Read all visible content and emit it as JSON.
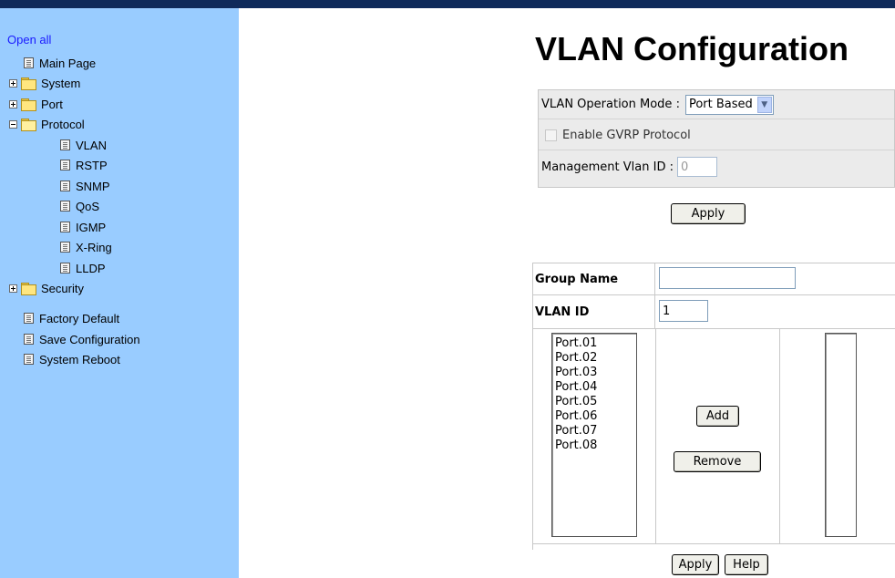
{
  "sidebar": {
    "open_all": "Open all",
    "items": [
      {
        "label": "Main Page",
        "icon": "page-icon"
      },
      {
        "label": "System",
        "icon": "folder-icon"
      },
      {
        "label": "Port",
        "icon": "folder-icon"
      },
      {
        "label": "Protocol",
        "icon": "folder-open-icon"
      },
      {
        "label": "VLAN",
        "icon": "page-icon"
      },
      {
        "label": "RSTP",
        "icon": "page-icon"
      },
      {
        "label": "SNMP",
        "icon": "page-icon"
      },
      {
        "label": "QoS",
        "icon": "page-icon"
      },
      {
        "label": "IGMP",
        "icon": "page-icon"
      },
      {
        "label": "X-Ring",
        "icon": "page-icon"
      },
      {
        "label": "LLDP",
        "icon": "page-icon"
      },
      {
        "label": "Security",
        "icon": "folder-icon"
      },
      {
        "label": "Factory Default",
        "icon": "page-icon"
      },
      {
        "label": "Save Configuration",
        "icon": "page-icon"
      },
      {
        "label": "System Reboot",
        "icon": "page-icon"
      }
    ]
  },
  "main": {
    "title": "VLAN Configuration",
    "mode_label": "VLAN Operation Mode :",
    "mode_value": "Port Based",
    "gvrp_label": "Enable GVRP Protocol",
    "mgmt_label": "Management Vlan ID :",
    "mgmt_value": "0",
    "apply_label": "Apply"
  },
  "group": {
    "name_label": "Group Name",
    "name_value": "",
    "vlan_id_label": "VLAN ID",
    "vlan_id_value": "1",
    "ports": [
      "Port.01",
      "Port.02",
      "Port.03",
      "Port.04",
      "Port.05",
      "Port.06",
      "Port.07",
      "Port.08"
    ],
    "add_label": "Add",
    "remove_label": "Remove"
  },
  "footer": {
    "apply_label": "Apply",
    "help_label": "Help"
  },
  "colors": {
    "sidebar_bg": "#99ccff",
    "topbar": "#0f2a5a",
    "link": "#1a1aff"
  }
}
